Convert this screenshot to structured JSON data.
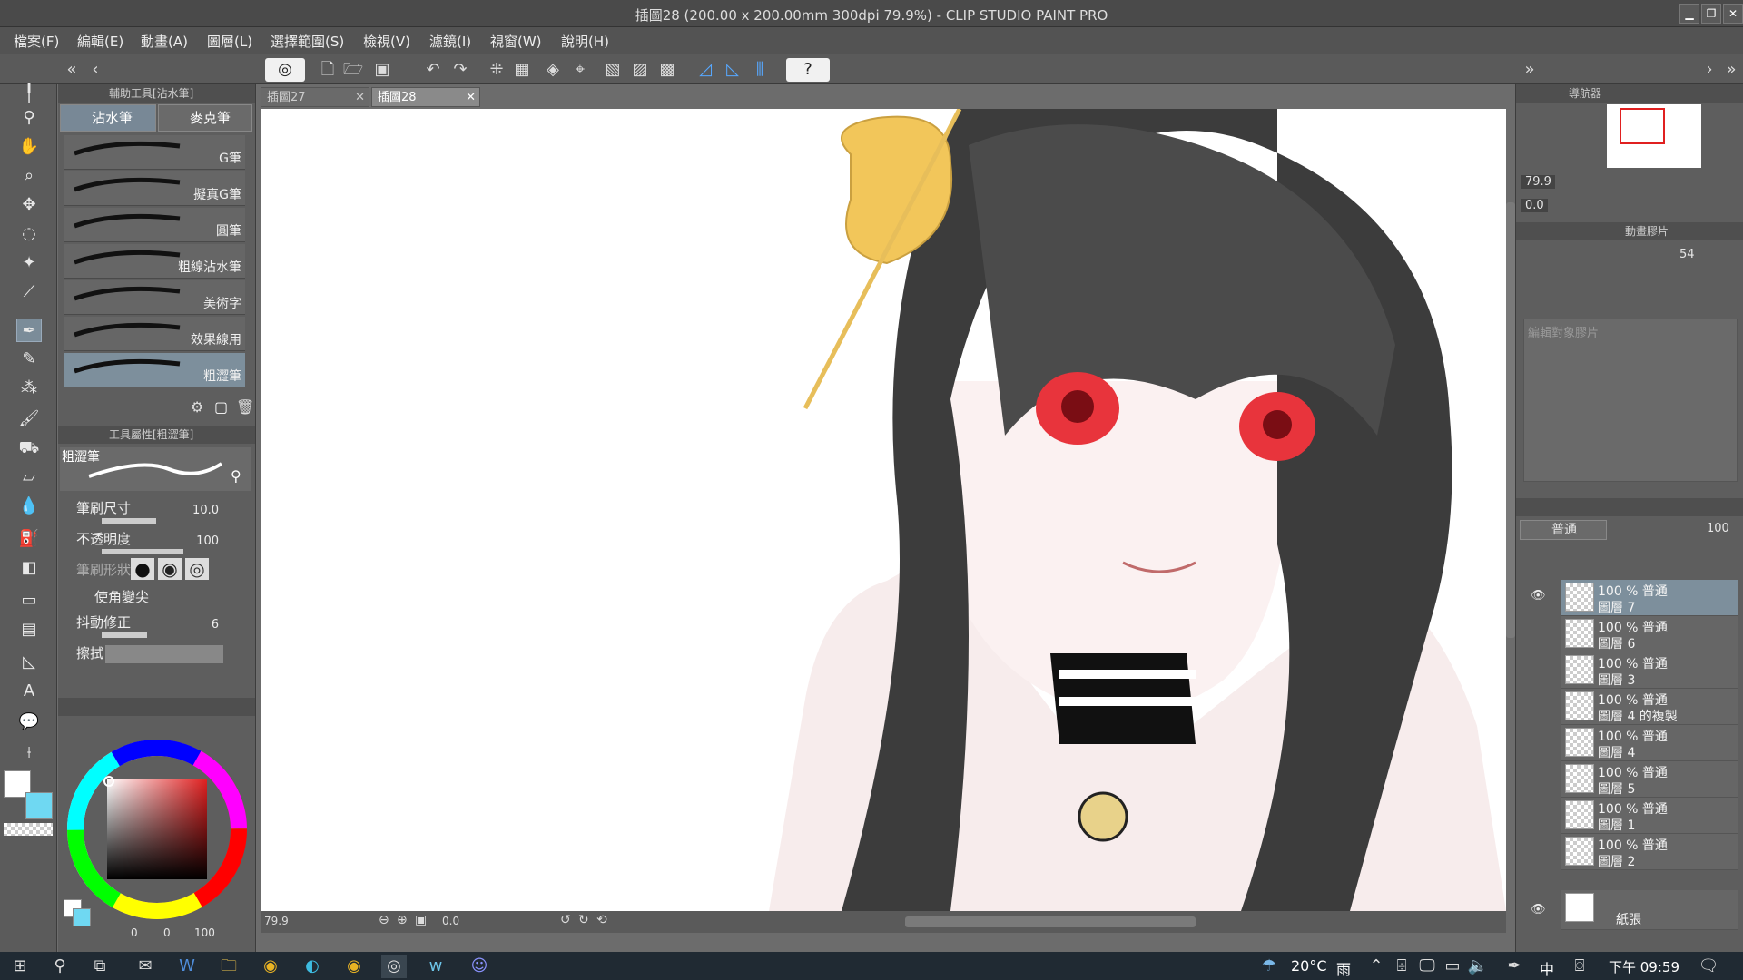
{
  "window": {
    "title": "插圖28 (200.00 x 200.00mm 300dpi 79.9%)  - CLIP STUDIO PAINT PRO"
  },
  "menu": [
    "檔案(F)",
    "編輯(E)",
    "動畫(A)",
    "圖層(L)",
    "選擇範圍(S)",
    "檢視(V)",
    "濾鏡(I)",
    "視窗(W)",
    "說明(H)"
  ],
  "subtool": {
    "header": "輔助工具[沾水筆]",
    "tabs": [
      "沾水筆",
      "麥克筆"
    ],
    "brushes": [
      "G筆",
      "擬真G筆",
      "圓筆",
      "粗線沾水筆",
      "美術字",
      "效果線用",
      "粗澀筆"
    ]
  },
  "tool_property": {
    "header": "工具屬性[粗澀筆]",
    "preset_name": "粗澀筆",
    "brush_size_label": "筆刷尺寸",
    "brush_size_value": "10.0",
    "opacity_label": "不透明度",
    "opacity_value": "100",
    "shape_label": "筆刷形狀",
    "taper_label": "使角變尖",
    "stabilize_label": "抖動修正",
    "stabilize_value": "6",
    "wipe_label": "擦拭"
  },
  "color": {
    "main": "#ffffff",
    "sub": "#6fd8f2",
    "small_values": [
      "0",
      "0",
      "100"
    ]
  },
  "doc_tabs": [
    "插圖27",
    "插圖28"
  ],
  "canvas_footer": {
    "zoom": "79.9",
    "angle": "0.0"
  },
  "navigator": {
    "header": "導航器",
    "zoom": "79.9",
    "angle": "0.0"
  },
  "animation": {
    "header": "動畫膠片",
    "frame": "54",
    "hint": "編輯對象膠片"
  },
  "layers": {
    "blend_mode": "普通",
    "opacity": "100",
    "items": [
      {
        "mode": "100 % 普通",
        "name": "圖層 7"
      },
      {
        "mode": "100 % 普通",
        "name": "圖層 6"
      },
      {
        "mode": "100 % 普通",
        "name": "圖層 3"
      },
      {
        "mode": "100 % 普通",
        "name": "圖層 4 的複製"
      },
      {
        "mode": "100 % 普通",
        "name": "圖層 4"
      },
      {
        "mode": "100 % 普通",
        "name": "圖層 5"
      },
      {
        "mode": "100 % 普通",
        "name": "圖層 1"
      },
      {
        "mode": "100 % 普通",
        "name": "圖層 2"
      }
    ],
    "paper": "紙張"
  },
  "taskbar": {
    "temp": "20°C",
    "weather": "雨",
    "ime": "中",
    "time": "下午 09:59"
  }
}
